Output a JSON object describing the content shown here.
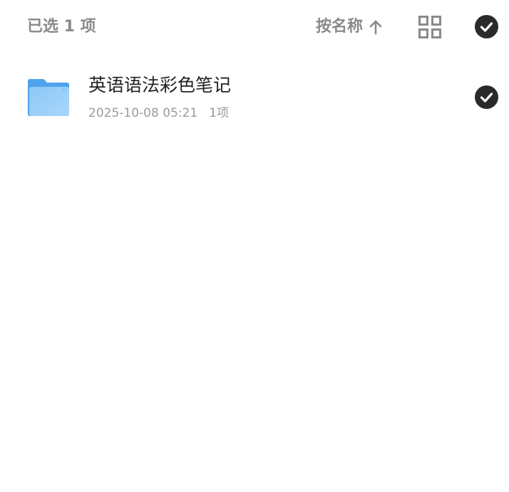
{
  "header": {
    "selected_label": "已选 1 项",
    "sort_label": "按名称",
    "sort_icon": "arrow-up-icon",
    "view_icon": "grid-view-icon",
    "select_all_icon": "check-circle-icon",
    "select_all_checked": true
  },
  "items": [
    {
      "title": "英语语法彩色笔记",
      "date": "2025-10-08 05:21",
      "count": "1项",
      "icon": "folder-icon",
      "checked": true
    }
  ],
  "colors": {
    "muted_text": "#8a8a8a",
    "title_text": "#222222",
    "meta_text": "#9a9a9a",
    "check_fill": "#2a2a2a",
    "folder_blue": "#5aaaf0"
  }
}
